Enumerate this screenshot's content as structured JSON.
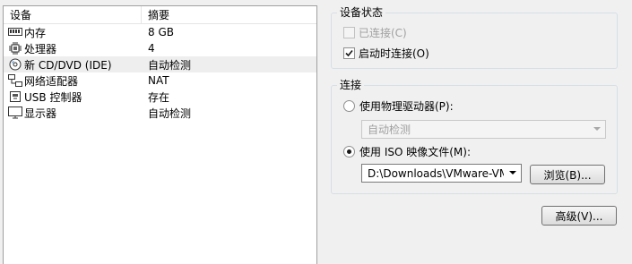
{
  "devices": {
    "header": {
      "device": "设备",
      "summary": "摘要"
    },
    "items": [
      {
        "icon": "memory-icon",
        "name": "内存",
        "summary": "8 GB"
      },
      {
        "icon": "processor-icon",
        "name": "处理器",
        "summary": "4"
      },
      {
        "icon": "cd-dvd-icon",
        "name": "新 CD/DVD (IDE)",
        "summary": "自动检测"
      },
      {
        "icon": "network-adapter-icon",
        "name": "网络适配器",
        "summary": "NAT"
      },
      {
        "icon": "usb-controller-icon",
        "name": "USB 控制器",
        "summary": "存在"
      },
      {
        "icon": "display-icon",
        "name": "显示器",
        "summary": "自动检测"
      }
    ]
  },
  "device_status": {
    "title": "设备状态",
    "connected_label": "已连接(C)",
    "connected_checked": false,
    "connected_enabled": false,
    "connect_on_power_on_label": "启动时连接(O)",
    "connect_on_power_on_checked": true
  },
  "connection": {
    "title": "连接",
    "physical_drive_label": "使用物理驱动器(P):",
    "physical_drive_value": "自动检测",
    "iso_label": "使用 ISO 映像文件(M):",
    "iso_value": "D:\\Downloads\\VMware-VMv",
    "selected": "iso",
    "browse_label": "浏览(B)..."
  },
  "advanced_label": "高级(V)..."
}
